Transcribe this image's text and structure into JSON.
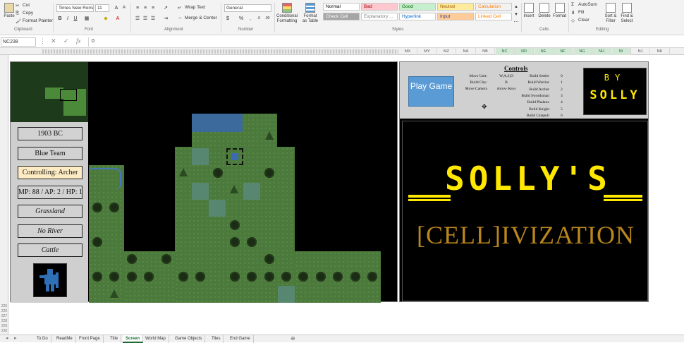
{
  "ribbon": {
    "clipboard": {
      "paste": "Paste",
      "cut": "Cut",
      "copy": "Copy",
      "format_painter": "Format Painter",
      "label": "Clipboard"
    },
    "font": {
      "name": "Times New Roma",
      "size": "11",
      "label": "Font"
    },
    "alignment": {
      "wrap": "Wrap Text",
      "merge": "Merge & Center",
      "label": "Alignment"
    },
    "number": {
      "format": "General",
      "label": "Number",
      "currency": "$",
      "percent": "%"
    },
    "styles": {
      "conditional": "Conditional Formatting",
      "format_table": "Format as Table",
      "items": [
        {
          "label": "Normal",
          "bg": "#ffffff",
          "fg": "#000000"
        },
        {
          "label": "Bad",
          "bg": "#ffc7ce",
          "fg": "#9c0006"
        },
        {
          "label": "Good",
          "bg": "#c6efce",
          "fg": "#006100"
        },
        {
          "label": "Neutral",
          "bg": "#ffeb9c",
          "fg": "#9c5700"
        },
        {
          "label": "Calculation",
          "bg": "#f2f2f2",
          "fg": "#fa7d00"
        },
        {
          "label": "Check Cell",
          "bg": "#a5a5a5",
          "fg": "#ffffff"
        },
        {
          "label": "Explanatory ...",
          "bg": "#ffffff",
          "fg": "#7f7f7f"
        },
        {
          "label": "Hyperlink",
          "bg": "#ffffff",
          "fg": "#0563c1"
        },
        {
          "label": "Input",
          "bg": "#ffcc99",
          "fg": "#3f3f76"
        },
        {
          "label": "Linked Cell",
          "bg": "#ffffff",
          "fg": "#fa7d00"
        }
      ],
      "label": "Styles"
    },
    "cells": {
      "insert": "Insert",
      "delete": "Delete",
      "format": "Format",
      "label": "Cells"
    },
    "editing": {
      "autosum": "AutoSum",
      "fill": "Fill",
      "clear": "Clear",
      "sort": "Sort & Filter",
      "find": "Find & Select",
      "label": "Editing"
    }
  },
  "formula_bar": {
    "name_box": "NC238",
    "value": "0",
    "fx": "fx"
  },
  "columns": [
    "MX",
    "MY",
    "MZ",
    "NA",
    "NB",
    "NC",
    "ND",
    "NE",
    "NF",
    "NG",
    "NH",
    "NI",
    "NJ",
    "NK"
  ],
  "selected_columns": [
    "NC",
    "ND",
    "NE",
    "NF",
    "NG",
    "NH",
    "NI"
  ],
  "rows_visible": [
    "225",
    "226",
    "227",
    "228",
    "229",
    "230"
  ],
  "game": {
    "info": [
      {
        "text": "1903 BC",
        "style": "normal"
      },
      {
        "text": "Blue Team",
        "style": "normal"
      },
      {
        "text": "Controlling: Archer",
        "style": "active"
      },
      {
        "text": "MP: 88 / AP: 2 / HP: 1",
        "style": "normal"
      },
      {
        "text": "Grassland",
        "style": "italic"
      },
      {
        "text": "No River",
        "style": "italic"
      },
      {
        "text": "Cattle",
        "style": "italic"
      }
    ]
  },
  "panel": {
    "play_button": "Play Game",
    "controls_title": "Controls",
    "move_controls": [
      {
        "action": "Move Unit:",
        "key": "W,A,S,D"
      },
      {
        "action": "Build City:",
        "key": "B"
      },
      {
        "action": "Move Camera",
        "key": "Arrow Keys"
      }
    ],
    "build_controls": [
      {
        "action": "Build Settler",
        "key": "0"
      },
      {
        "action": "Build Warrior",
        "key": "1"
      },
      {
        "action": "Build Archer",
        "key": "2"
      },
      {
        "action": "Build Swordsman",
        "key": "3"
      },
      {
        "action": "Build Phalanx",
        "key": "4"
      },
      {
        "action": "Build Knight",
        "key": "5"
      },
      {
        "action": "Build Catapult",
        "key": "6"
      }
    ],
    "by": "BY",
    "author": "SOLLY",
    "title_top": "SOLLY'S",
    "title_bottom": "[CELL]IVIZATION"
  },
  "tabs": [
    "To Do",
    "ReadMe",
    "Front Page",
    "Title",
    "Screen",
    "World Map",
    "Game Objects",
    "Tiles",
    "End Game"
  ],
  "active_tab": "Screen",
  "colors": {
    "accent": "#1e6b35",
    "title_yellow": "#ffe800",
    "title_gold": "#b8861c",
    "play_button": "#5b9bd5"
  }
}
